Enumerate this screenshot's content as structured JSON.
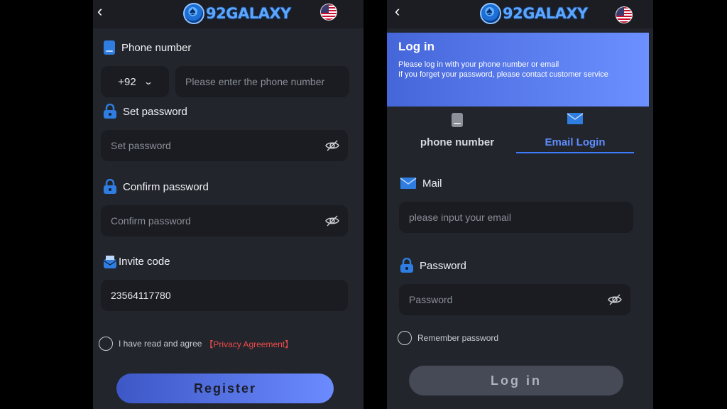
{
  "brand": {
    "name": "92GALAXY"
  },
  "colors": {
    "accent": "#5e8dff",
    "privacy_link": "#ef4b4b",
    "background": "#22252c"
  },
  "register": {
    "phone_label": "Phone number",
    "country_code": "+92",
    "phone_placeholder": "Please enter the phone number",
    "set_password_label": "Set password",
    "set_password_placeholder": "Set password",
    "confirm_password_label": "Confirm password",
    "confirm_password_placeholder": "Confirm password",
    "invite_label": "Invite code",
    "invite_value": "23564117780",
    "agree_text": "I have read and agree",
    "privacy_link": "【Privacy Agreement】",
    "register_button": "Register"
  },
  "login": {
    "title": "Log in",
    "subtitle_1": "Please log in with your phone number or email",
    "subtitle_2": "If you forget your password, please contact customer service",
    "tabs": [
      {
        "label": "phone number",
        "icon": "phone-icon",
        "active": false
      },
      {
        "label": "Email Login",
        "icon": "mail-icon",
        "active": true
      }
    ],
    "mail_label": "Mail",
    "mail_placeholder": "please input your email",
    "password_label": "Password",
    "password_placeholder": "Password",
    "remember_label": "Remember password",
    "login_button": "Log in"
  },
  "icons": [
    "back-arrow-icon",
    "flag-us-icon",
    "phone-icon",
    "lock-icon",
    "invite-icon",
    "mail-icon",
    "eye-off-icon",
    "chevron-down-icon"
  ]
}
